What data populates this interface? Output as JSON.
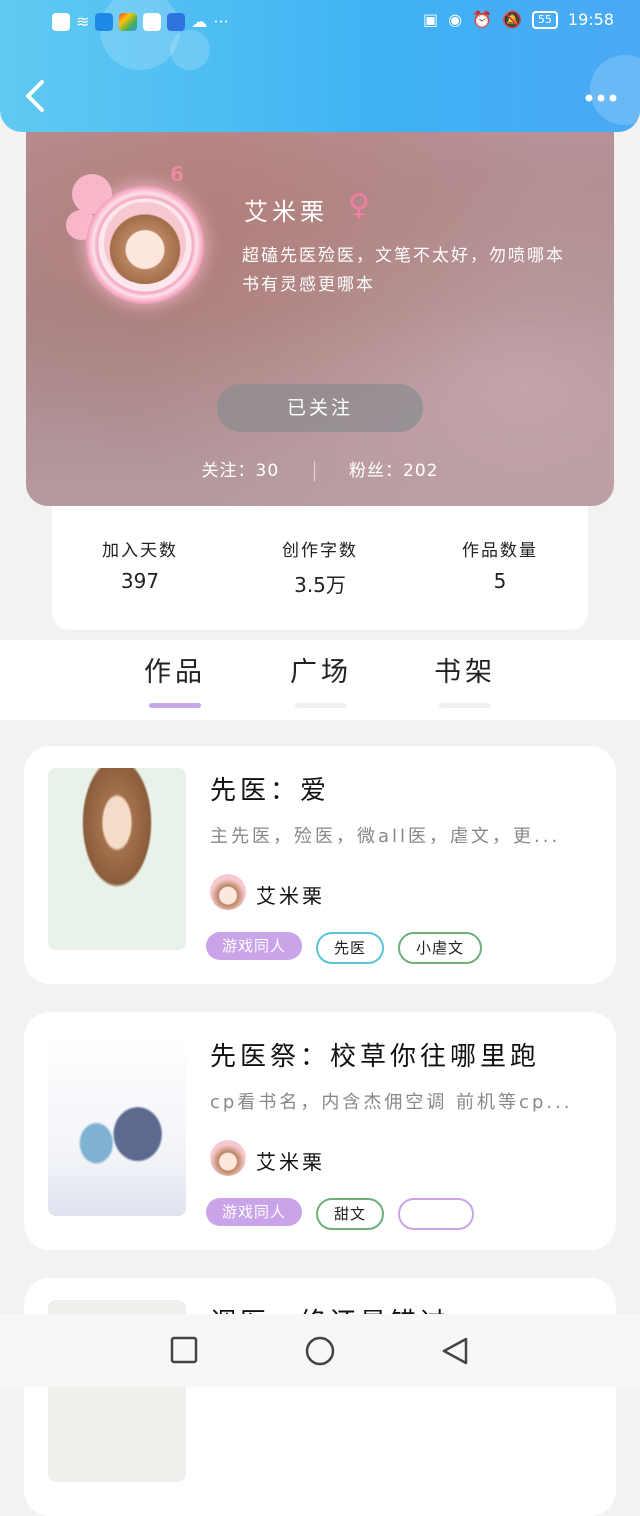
{
  "status_bar": {
    "time": "19:58",
    "battery": "55"
  },
  "profile": {
    "name": "艾米栗",
    "gender_symbol": "♀",
    "level": "6",
    "bio": "超磕先医殓医，文笔不太好，勿喷哪本书有灵感更哪本",
    "follow_button": "已关注",
    "following_label": "关注：30",
    "fans_label": "粉丝：202"
  },
  "stats": [
    {
      "label": "加入天数",
      "value": "397"
    },
    {
      "label": "创作字数",
      "value": "3.5万"
    },
    {
      "label": "作品数量",
      "value": "5"
    }
  ],
  "tabs": [
    {
      "label": "作品",
      "active": true
    },
    {
      "label": "广场",
      "active": false
    },
    {
      "label": "书架",
      "active": false
    }
  ],
  "works": [
    {
      "title": "先医：爱",
      "desc": "主先医，殓医，微all医，虐文，更...",
      "author": "艾米栗",
      "tags": [
        "游戏同人",
        "先医",
        "小虐文"
      ]
    },
    {
      "title": "先医祭：校草你往哪里跑",
      "desc": "cp看书名，内含杰佣空调 前机等cp...",
      "author": "艾米栗",
      "tags": [
        "游戏同人",
        "甜文",
        ""
      ]
    },
    {
      "title": "调医：终还是错过",
      "desc": "",
      "author": "",
      "tags": []
    }
  ],
  "colors": {
    "accent": "#c9a8e6",
    "topbar": "#3fb2f3"
  }
}
